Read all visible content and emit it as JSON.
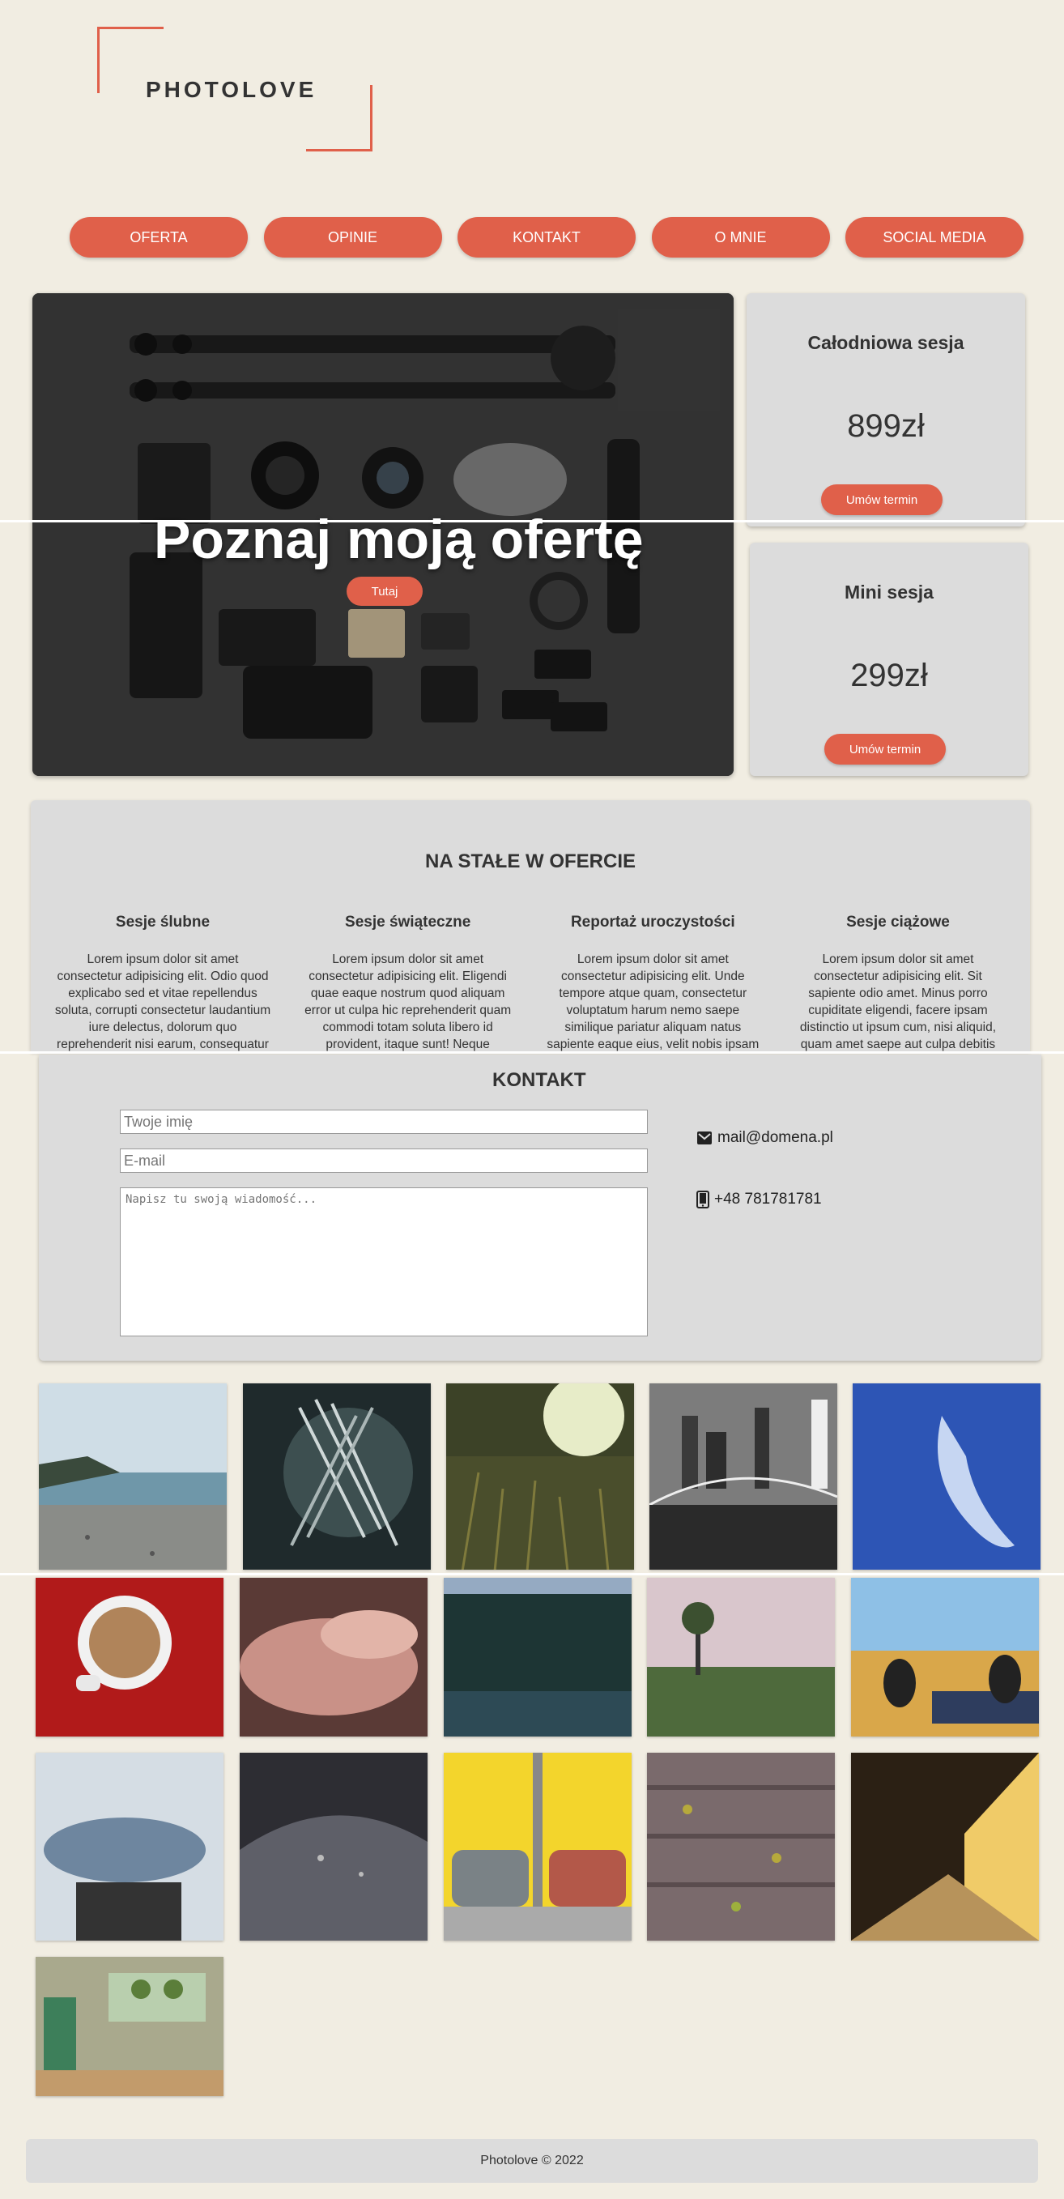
{
  "brand": {
    "logo_text": "PHOTOLOVE"
  },
  "nav": [
    {
      "label": "OFERTA"
    },
    {
      "label": "OPINIE"
    },
    {
      "label": "KONTAKT"
    },
    {
      "label": "O MNIE"
    },
    {
      "label": "SOCIAL MEDIA"
    }
  ],
  "hero": {
    "title": "Poznaj moją ofertę",
    "button": "Tutaj"
  },
  "pricing": [
    {
      "title": "Całodniowa sesja",
      "price": "899zł",
      "button": "Umów termin"
    },
    {
      "title": "Mini sesja",
      "price": "299zł",
      "button": "Umów termin"
    }
  ],
  "offer": {
    "title": "NA STAŁE W OFERCIE",
    "items": [
      {
        "title": "Sesje ślubne",
        "text": "Lorem ipsum dolor sit amet consectetur adipisicing elit. Odio quod explicabo sed et vitae repellendus soluta, corrupti consectetur laudantium iure delectus, dolorum quo reprehenderit nisi earum, consequatur"
      },
      {
        "title": "Sesje świąteczne",
        "text": "Lorem ipsum dolor sit amet consectetur adipisicing elit. Eligendi quae eaque nostrum quod aliquam error ut culpa hic reprehenderit quam commodi totam soluta libero id provident, itaque sunt! Neque"
      },
      {
        "title": "Reportaż uroczystości",
        "text": "Lorem ipsum dolor sit amet consectetur adipisicing elit. Unde tempore atque quam, consectetur voluptatum harum nemo saepe similique pariatur aliquam natus sapiente eaque eius, velit nobis ipsam"
      },
      {
        "title": "Sesje ciążowe",
        "text": "Lorem ipsum dolor sit amet consectetur adipisicing elit. Sit sapiente odio amet. Minus porro cupiditate eligendi, facere ipsam distinctio ut ipsum cum, nisi aliquid, quam amet saepe aut culpa debitis"
      }
    ]
  },
  "contact": {
    "title": "KONTAKT",
    "name_placeholder": "Twoje imię",
    "email_placeholder": "E-mail",
    "message_placeholder": "Napisz tu swoją wiadomość...",
    "email": "mail@domena.pl",
    "phone": "+48 781781781"
  },
  "gallery": [
    {
      "icon": "beach-photo"
    },
    {
      "icon": "forks-photo"
    },
    {
      "icon": "meadow-sunset-photo"
    },
    {
      "icon": "bridge-city-photo"
    },
    {
      "icon": "blue-sky-photo"
    },
    {
      "icon": "coffee-cup-photo"
    },
    {
      "icon": "hands-photo"
    },
    {
      "icon": "forest-photo"
    },
    {
      "icon": "field-tree-photo"
    },
    {
      "icon": "sneakers-field-photo"
    },
    {
      "icon": "steam-mug-photo"
    },
    {
      "icon": "water-drops-photo"
    },
    {
      "icon": "cars-garage-photo"
    },
    {
      "icon": "wood-leaves-photo"
    },
    {
      "icon": "corridor-photo"
    },
    {
      "icon": "plants-window-photo"
    }
  ],
  "footer": {
    "text": "Photolove © 2022"
  },
  "colors": {
    "accent": "#e0604a",
    "background": "#f1ede2",
    "card": "#dcdcdc"
  }
}
